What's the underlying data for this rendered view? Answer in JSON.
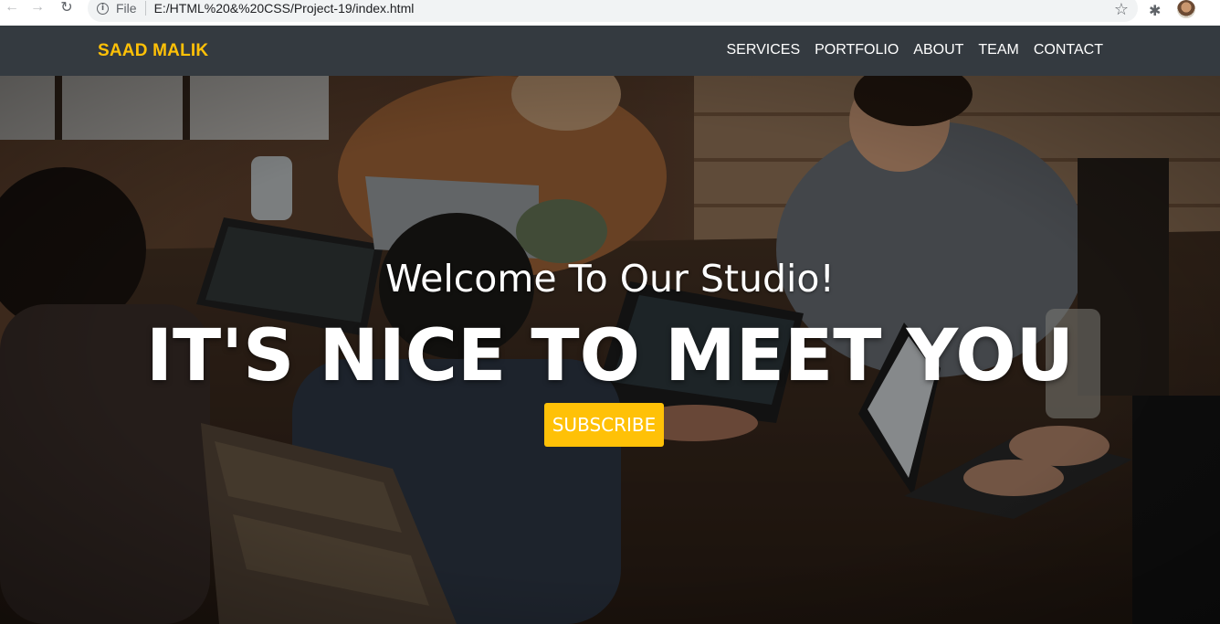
{
  "browser": {
    "file_label": "File",
    "url": "E:/HTML%20&%20CSS/Project-19/index.html",
    "icons": [
      "back-icon",
      "forward-icon",
      "reload-icon",
      "info-icon",
      "star-icon",
      "extensions-icon",
      "profile-avatar"
    ]
  },
  "header": {
    "brand": "SAAD MALIK",
    "nav": [
      "SERVICES",
      "PORTFOLIO",
      "ABOUT",
      "TEAM",
      "CONTACT"
    ]
  },
  "hero": {
    "welcome": "Welcome To Our Studio!",
    "headline": "IT'S NICE TO MEET YOU",
    "button": "SUBSCRIBE"
  },
  "colors": {
    "accent": "#ffc107",
    "header_bg": "#343a40",
    "text_light": "#ffffff"
  }
}
